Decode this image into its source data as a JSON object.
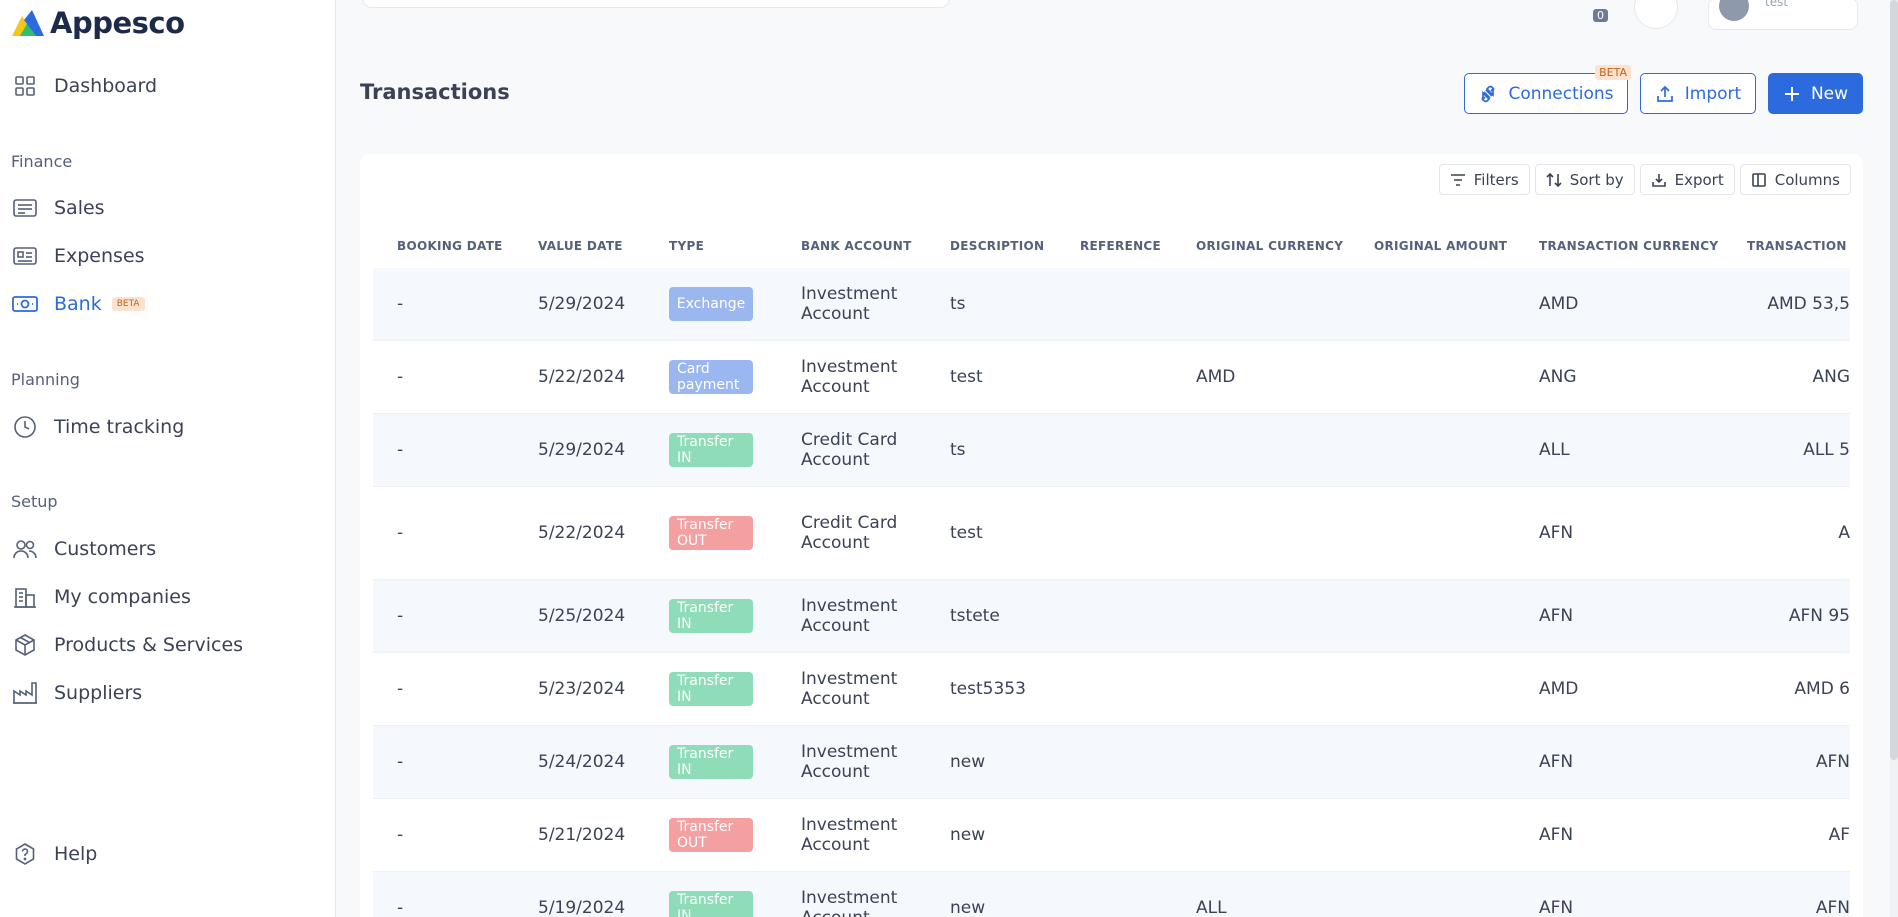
{
  "app": {
    "name": "Appesco"
  },
  "sidebar": {
    "dashboard": "Dashboard",
    "sections": {
      "finance": "Finance",
      "planning": "Planning",
      "setup": "Setup"
    },
    "finance_items": [
      {
        "label": "Sales",
        "icon": "sales-icon"
      },
      {
        "label": "Expenses",
        "icon": "expenses-icon"
      },
      {
        "label": "Bank",
        "icon": "bank-icon",
        "badge": "BETA",
        "active": true
      }
    ],
    "planning_items": [
      {
        "label": "Time tracking",
        "icon": "clock-icon"
      }
    ],
    "setup_items": [
      {
        "label": "Customers",
        "icon": "customers-icon"
      },
      {
        "label": "My companies",
        "icon": "companies-icon"
      },
      {
        "label": "Products & Services",
        "icon": "box-icon"
      },
      {
        "label": "Suppliers",
        "icon": "factory-icon"
      }
    ],
    "help": "Help"
  },
  "header": {
    "notification_count": "0",
    "user_name": "test"
  },
  "page": {
    "title": "Transactions",
    "connections_label": "Connections",
    "connections_badge": "BETA",
    "import_label": "Import",
    "new_label": "New"
  },
  "toolbar": {
    "filters": "Filters",
    "sort": "Sort by",
    "export": "Export",
    "columns": "Columns"
  },
  "table": {
    "columns": [
      "BOOKING DATE",
      "VALUE DATE",
      "TYPE",
      "BANK ACCOUNT",
      "DESCRIPTION",
      "REFERENCE",
      "ORIGINAL CURRENCY",
      "ORIGINAL AMOUNT",
      "TRANSACTION CURRENCY",
      "TRANSACTION A"
    ],
    "rows": [
      {
        "booking": "-",
        "value": "5/29/2024",
        "type": "Exchange",
        "type_color": "#9bb7f0",
        "account": "Investment Account",
        "desc": "ts",
        "orig_cur": "",
        "tx_cur": "AMD",
        "tx_amt": "AMD 53,5"
      },
      {
        "booking": "-",
        "value": "5/22/2024",
        "type": "Card payment",
        "type_color": "#9bb7f0",
        "account": "Investment Account",
        "desc": "test",
        "orig_cur": "AMD",
        "tx_cur": "ANG",
        "tx_amt": "ANG"
      },
      {
        "booking": "-",
        "value": "5/29/2024",
        "type": "Transfer IN",
        "type_color": "#8fdcb8",
        "account": "Credit Card Account",
        "desc": "ts",
        "orig_cur": "",
        "tx_cur": "ALL",
        "tx_amt": "ALL 5"
      },
      {
        "booking": "-",
        "value": "5/22/2024",
        "type": "Transfer OUT",
        "type_color": "#f4a0a0",
        "account": "Credit Card Account",
        "desc": "test",
        "orig_cur": "",
        "tx_cur": "AFN",
        "tx_amt": "A"
      },
      {
        "booking": "-",
        "value": "5/25/2024",
        "type": "Transfer IN",
        "type_color": "#8fdcb8",
        "account": "Investment Account",
        "desc": "tstete",
        "orig_cur": "",
        "tx_cur": "AFN",
        "tx_amt": "AFN 95"
      },
      {
        "booking": "-",
        "value": "5/23/2024",
        "type": "Transfer IN",
        "type_color": "#8fdcb8",
        "account": "Investment Account",
        "desc": "test5353",
        "orig_cur": "",
        "tx_cur": "AMD",
        "tx_amt": "AMD 6"
      },
      {
        "booking": "-",
        "value": "5/24/2024",
        "type": "Transfer IN",
        "type_color": "#8fdcb8",
        "account": "Investment Account",
        "desc": "new",
        "orig_cur": "",
        "tx_cur": "AFN",
        "tx_amt": "AFN"
      },
      {
        "booking": "-",
        "value": "5/21/2024",
        "type": "Transfer OUT",
        "type_color": "#f4a0a0",
        "account": "Investment Account",
        "desc": "new",
        "orig_cur": "",
        "tx_cur": "AFN",
        "tx_amt": "AF"
      },
      {
        "booking": "-",
        "value": "5/19/2024",
        "type": "Transfer IN",
        "type_color": "#8fdcb8",
        "account": "Investment Account",
        "desc": "new",
        "orig_cur": "ALL",
        "tx_cur": "AFN",
        "tx_amt": "AFN"
      }
    ]
  },
  "colors": {
    "accent": "#2c6bde",
    "exchange": "#9bb7f0",
    "transfer_in": "#8fdcb8",
    "transfer_out": "#f4a0a0"
  }
}
